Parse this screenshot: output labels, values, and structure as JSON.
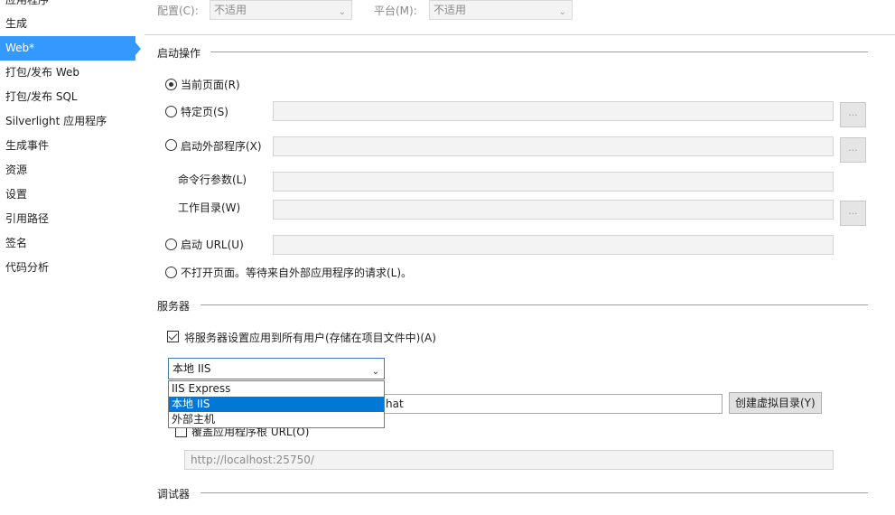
{
  "sidebar": {
    "items": [
      {
        "label": "应用程序"
      },
      {
        "label": "生成"
      },
      {
        "label": "Web*"
      },
      {
        "label": "打包/发布 Web"
      },
      {
        "label": "打包/发布 SQL"
      },
      {
        "label": "Silverlight 应用程序"
      },
      {
        "label": "生成事件"
      },
      {
        "label": "资源"
      },
      {
        "label": "设置"
      },
      {
        "label": "引用路径"
      },
      {
        "label": "签名"
      },
      {
        "label": "代码分析"
      }
    ],
    "active_index": 2
  },
  "config_bar": {
    "config_label": "配置(C):",
    "config_value": "不适用",
    "platform_label": "平台(M):",
    "platform_value": "不适用"
  },
  "start_action": {
    "title": "启动操作",
    "current_page": "当前页面(R)",
    "specific_page": "特定页(S)",
    "start_external": "启动外部程序(X)",
    "cmd_args": "命令行参数(L)",
    "working_dir": "工作目录(W)",
    "start_url": "启动 URL(U)",
    "dont_open": "不打开页面。等待来自外部应用程序的请求(L)。",
    "browse_label": "..."
  },
  "servers": {
    "title": "服务器",
    "apply_all_label": "将服务器设置应用到所有用户(存储在项目文件中)(A)",
    "server_type_value": "本地 IIS",
    "dropdown_options": [
      "IIS Express",
      "本地 IIS",
      "外部主机"
    ],
    "dropdown_selected_index": 1,
    "project_url_value_tail": "hat",
    "create_vdir_label": "创建虚拟目录(Y)",
    "override_root_label": "覆盖应用程序根 URL(O)",
    "root_url_value": "http://localhost:25750/"
  },
  "debuggers": {
    "title": "调试器"
  }
}
